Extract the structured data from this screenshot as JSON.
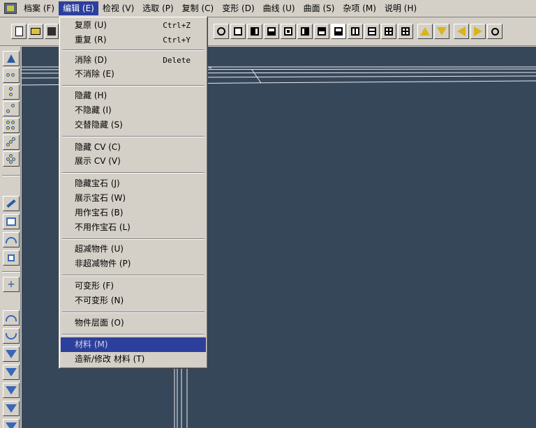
{
  "menubar": {
    "items": [
      "档案 (F)",
      "编辑 (E)",
      "检视 (V)",
      "选取 (P)",
      "复制 (C)",
      "变形 (D)",
      "曲线 (U)",
      "曲面 (S)",
      "杂项 (M)",
      "说明 (H)"
    ],
    "active_index": 1
  },
  "edit_menu": {
    "items": [
      {
        "label": "复原 (U)",
        "shortcut": "Ctrl+Z"
      },
      {
        "label": "重复 (R)",
        "shortcut": "Ctrl+Y"
      },
      {
        "label": "消除 (D)",
        "shortcut": "Delete"
      },
      {
        "label": "不消除 (E)",
        "shortcut": ""
      },
      {
        "label": "隐藏 (H)",
        "shortcut": ""
      },
      {
        "label": "不隐藏 (I)",
        "shortcut": ""
      },
      {
        "label": "交替隐藏 (S)",
        "shortcut": ""
      },
      {
        "label": "隐藏 CV (C)",
        "shortcut": ""
      },
      {
        "label": "展示 CV (V)",
        "shortcut": ""
      },
      {
        "label": "隐藏宝石 (J)",
        "shortcut": ""
      },
      {
        "label": "展示宝石 (W)",
        "shortcut": ""
      },
      {
        "label": "用作宝石 (B)",
        "shortcut": ""
      },
      {
        "label": "不用作宝石 (L)",
        "shortcut": ""
      },
      {
        "label": "超减物件 (U)",
        "shortcut": ""
      },
      {
        "label": "非超减物件 (P)",
        "shortcut": ""
      },
      {
        "label": "可变形 (F)",
        "shortcut": ""
      },
      {
        "label": "不可变形 (N)",
        "shortcut": ""
      },
      {
        "label": "物件层面 (O)",
        "shortcut": ""
      },
      {
        "label": "材料 (M)",
        "shortcut": ""
      },
      {
        "label": "造新/修改 材料 (T)",
        "shortcut": ""
      }
    ],
    "selected_index": 18
  },
  "colors": {
    "viewport_bg": "#37475a",
    "menu_highlight": "#2c3f9c",
    "chrome": "#d4d0c8",
    "wire": "#e8ecf0"
  },
  "icons": {
    "toolbar_left": [
      "new-file-icon",
      "open-folder-icon",
      "save-icon"
    ],
    "toolbar_right": [
      "view-single-icon",
      "view-left-icon",
      "view-bottom-icon",
      "view-center-icon",
      "view-right-icon",
      "view-top-icon",
      "view-active-icon",
      "view-vsplit-icon",
      "view-hsplit-icon",
      "view-quad-icon",
      "view-quad-bold-icon",
      "arrow-up-icon",
      "arrow-down-icon",
      "arrow-left-icon",
      "arrow-right-icon",
      "zoom-icon"
    ]
  }
}
